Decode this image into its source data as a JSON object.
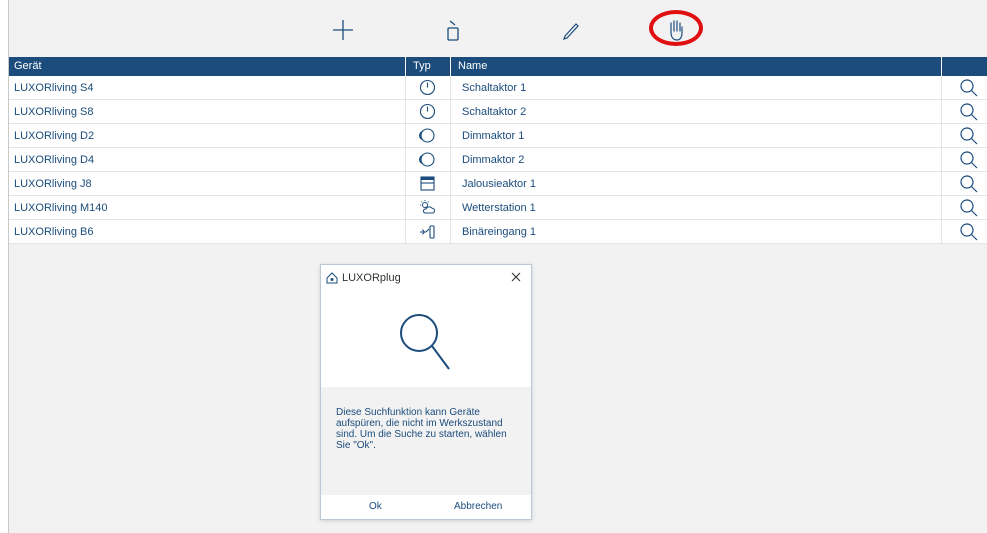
{
  "table": {
    "headers": {
      "device": "Gerät",
      "type": "Typ",
      "name": "Name"
    },
    "rows": [
      {
        "device": "LUXORliving S4",
        "type_icon": "timer-switch-icon",
        "name": "Schaltaktor 1"
      },
      {
        "device": "LUXORliving S8",
        "type_icon": "timer-switch-icon",
        "name": "Schaltaktor 2"
      },
      {
        "device": "LUXORliving D2",
        "type_icon": "dimmer-icon",
        "name": "Dimmaktor 1"
      },
      {
        "device": "LUXORliving D4",
        "type_icon": "dimmer-icon",
        "name": "Dimmaktor 2"
      },
      {
        "device": "LUXORliving J8",
        "type_icon": "blind-icon",
        "name": "Jalousieaktor 1"
      },
      {
        "device": "LUXORliving M140",
        "type_icon": "weather-station-icon",
        "name": "Wetterstation 1"
      },
      {
        "device": "LUXORliving B6",
        "type_icon": "binary-input-icon",
        "name": "Binäreingang 1"
      }
    ]
  },
  "toolbar": {
    "icons": [
      "add-icon",
      "device-icon",
      "edit-icon",
      "hand-icon"
    ],
    "highlight_color": "#e01010"
  },
  "dialog": {
    "title": "LUXORplug",
    "message": "Diese Suchfunktion kann Geräte aufspüren, die nicht im Werkszustand sind. Um die Suche zu starten, wählen Sie \"Ok\".",
    "ok_label": "Ok",
    "cancel_label": "Abbrechen"
  },
  "colors": {
    "accent": "#1b4c7c",
    "background": "#f2f2f2"
  }
}
